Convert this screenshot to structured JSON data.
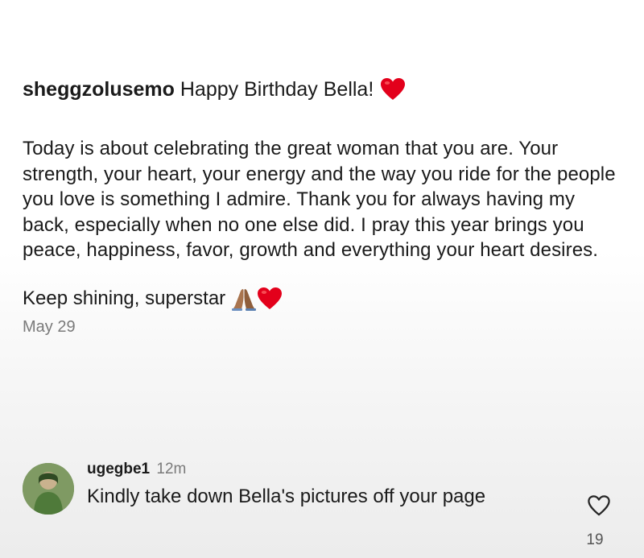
{
  "post": {
    "username": "sheggzolusemo",
    "title_text": "Happy Birthday Bella!",
    "paragraph": "Today is about celebrating the great woman that you are. Your strength, your heart, your energy and the way you ride for the people you love is something I admire. Thank you for always having my back, especially when no one else did. I pray this year brings you peace, happiness, favor, growth and everything your heart desires.",
    "signoff": "Keep shining, superstar",
    "date": "May 29",
    "icons": [
      "red-heart-emoji",
      "folded-hands-emoji"
    ]
  },
  "comment": {
    "username": "ugegbe1",
    "time": "12m",
    "text": "Kindly take down Bella's pictures off your page",
    "likes": "19",
    "icons": [
      "avatar",
      "heart-outline-icon"
    ]
  },
  "colors": {
    "text": "#1a1a1a",
    "muted": "#7a7a7a",
    "heart": "#e3001b"
  }
}
